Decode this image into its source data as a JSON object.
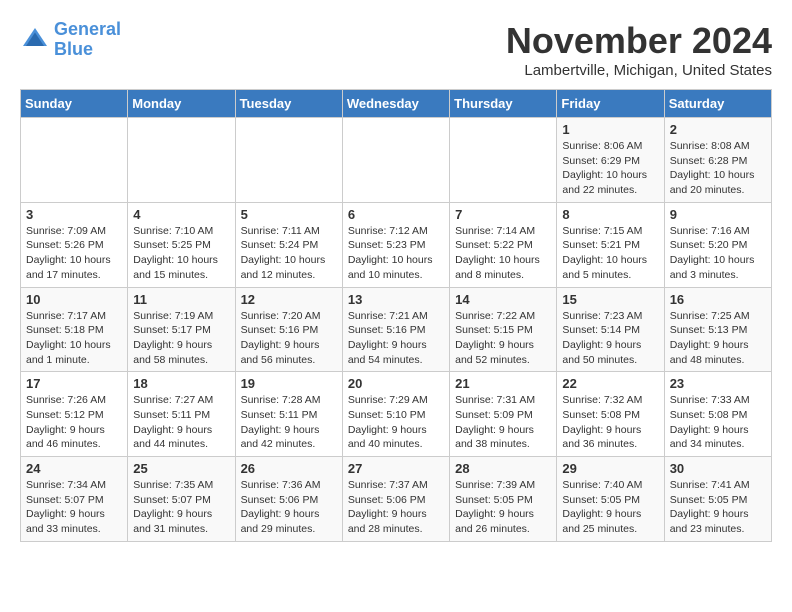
{
  "logo": {
    "line1": "General",
    "line2": "Blue"
  },
  "title": "November 2024",
  "location": "Lambertville, Michigan, United States",
  "weekdays": [
    "Sunday",
    "Monday",
    "Tuesday",
    "Wednesday",
    "Thursday",
    "Friday",
    "Saturday"
  ],
  "weeks": [
    [
      {
        "day": "",
        "info": ""
      },
      {
        "day": "",
        "info": ""
      },
      {
        "day": "",
        "info": ""
      },
      {
        "day": "",
        "info": ""
      },
      {
        "day": "",
        "info": ""
      },
      {
        "day": "1",
        "info": "Sunrise: 8:06 AM\nSunset: 6:29 PM\nDaylight: 10 hours\nand 22 minutes."
      },
      {
        "day": "2",
        "info": "Sunrise: 8:08 AM\nSunset: 6:28 PM\nDaylight: 10 hours\nand 20 minutes."
      }
    ],
    [
      {
        "day": "3",
        "info": "Sunrise: 7:09 AM\nSunset: 5:26 PM\nDaylight: 10 hours\nand 17 minutes."
      },
      {
        "day": "4",
        "info": "Sunrise: 7:10 AM\nSunset: 5:25 PM\nDaylight: 10 hours\nand 15 minutes."
      },
      {
        "day": "5",
        "info": "Sunrise: 7:11 AM\nSunset: 5:24 PM\nDaylight: 10 hours\nand 12 minutes."
      },
      {
        "day": "6",
        "info": "Sunrise: 7:12 AM\nSunset: 5:23 PM\nDaylight: 10 hours\nand 10 minutes."
      },
      {
        "day": "7",
        "info": "Sunrise: 7:14 AM\nSunset: 5:22 PM\nDaylight: 10 hours\nand 8 minutes."
      },
      {
        "day": "8",
        "info": "Sunrise: 7:15 AM\nSunset: 5:21 PM\nDaylight: 10 hours\nand 5 minutes."
      },
      {
        "day": "9",
        "info": "Sunrise: 7:16 AM\nSunset: 5:20 PM\nDaylight: 10 hours\nand 3 minutes."
      }
    ],
    [
      {
        "day": "10",
        "info": "Sunrise: 7:17 AM\nSunset: 5:18 PM\nDaylight: 10 hours\nand 1 minute."
      },
      {
        "day": "11",
        "info": "Sunrise: 7:19 AM\nSunset: 5:17 PM\nDaylight: 9 hours\nand 58 minutes."
      },
      {
        "day": "12",
        "info": "Sunrise: 7:20 AM\nSunset: 5:16 PM\nDaylight: 9 hours\nand 56 minutes."
      },
      {
        "day": "13",
        "info": "Sunrise: 7:21 AM\nSunset: 5:16 PM\nDaylight: 9 hours\nand 54 minutes."
      },
      {
        "day": "14",
        "info": "Sunrise: 7:22 AM\nSunset: 5:15 PM\nDaylight: 9 hours\nand 52 minutes."
      },
      {
        "day": "15",
        "info": "Sunrise: 7:23 AM\nSunset: 5:14 PM\nDaylight: 9 hours\nand 50 minutes."
      },
      {
        "day": "16",
        "info": "Sunrise: 7:25 AM\nSunset: 5:13 PM\nDaylight: 9 hours\nand 48 minutes."
      }
    ],
    [
      {
        "day": "17",
        "info": "Sunrise: 7:26 AM\nSunset: 5:12 PM\nDaylight: 9 hours\nand 46 minutes."
      },
      {
        "day": "18",
        "info": "Sunrise: 7:27 AM\nSunset: 5:11 PM\nDaylight: 9 hours\nand 44 minutes."
      },
      {
        "day": "19",
        "info": "Sunrise: 7:28 AM\nSunset: 5:11 PM\nDaylight: 9 hours\nand 42 minutes."
      },
      {
        "day": "20",
        "info": "Sunrise: 7:29 AM\nSunset: 5:10 PM\nDaylight: 9 hours\nand 40 minutes."
      },
      {
        "day": "21",
        "info": "Sunrise: 7:31 AM\nSunset: 5:09 PM\nDaylight: 9 hours\nand 38 minutes."
      },
      {
        "day": "22",
        "info": "Sunrise: 7:32 AM\nSunset: 5:08 PM\nDaylight: 9 hours\nand 36 minutes."
      },
      {
        "day": "23",
        "info": "Sunrise: 7:33 AM\nSunset: 5:08 PM\nDaylight: 9 hours\nand 34 minutes."
      }
    ],
    [
      {
        "day": "24",
        "info": "Sunrise: 7:34 AM\nSunset: 5:07 PM\nDaylight: 9 hours\nand 33 minutes."
      },
      {
        "day": "25",
        "info": "Sunrise: 7:35 AM\nSunset: 5:07 PM\nDaylight: 9 hours\nand 31 minutes."
      },
      {
        "day": "26",
        "info": "Sunrise: 7:36 AM\nSunset: 5:06 PM\nDaylight: 9 hours\nand 29 minutes."
      },
      {
        "day": "27",
        "info": "Sunrise: 7:37 AM\nSunset: 5:06 PM\nDaylight: 9 hours\nand 28 minutes."
      },
      {
        "day": "28",
        "info": "Sunrise: 7:39 AM\nSunset: 5:05 PM\nDaylight: 9 hours\nand 26 minutes."
      },
      {
        "day": "29",
        "info": "Sunrise: 7:40 AM\nSunset: 5:05 PM\nDaylight: 9 hours\nand 25 minutes."
      },
      {
        "day": "30",
        "info": "Sunrise: 7:41 AM\nSunset: 5:05 PM\nDaylight: 9 hours\nand 23 minutes."
      }
    ]
  ]
}
